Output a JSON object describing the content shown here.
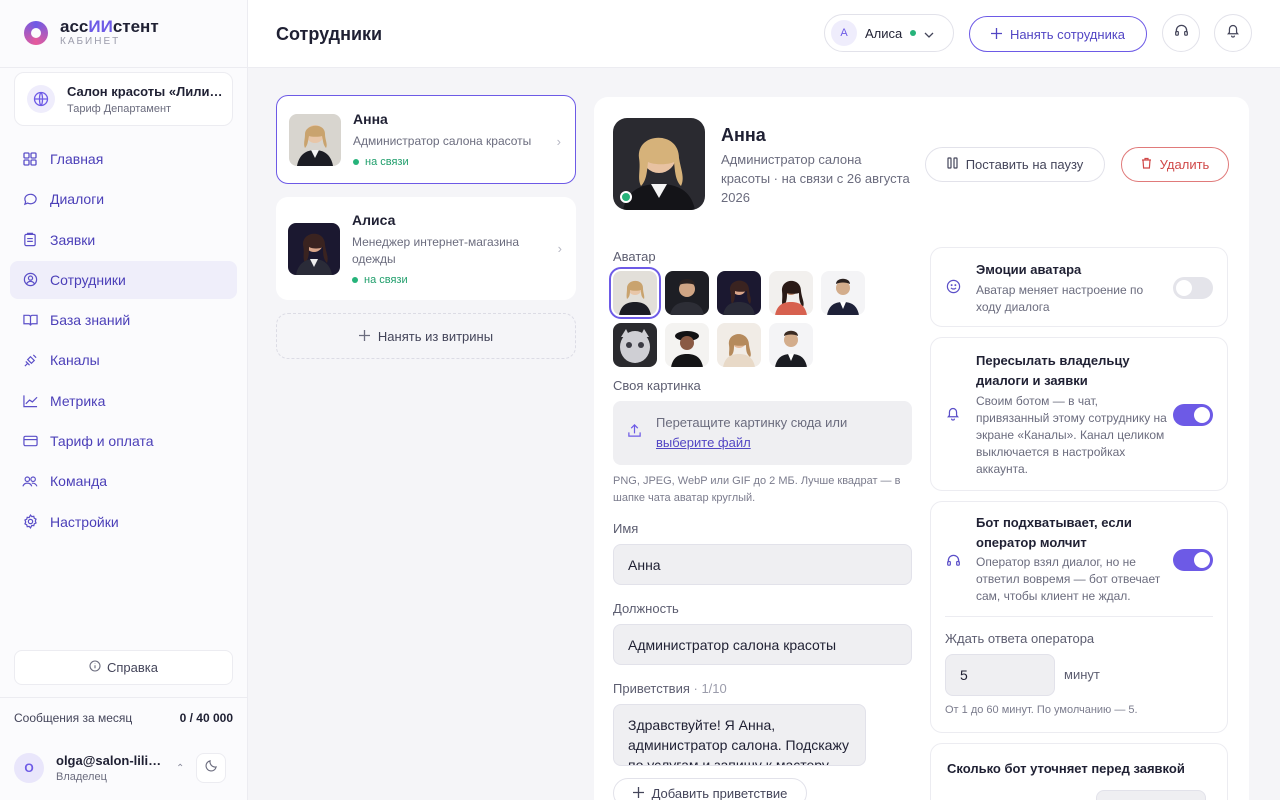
{
  "brand": {
    "name_a": "асс",
    "name_b": "ИИ",
    "name_c": "стент",
    "sub": "КАБИНЕТ"
  },
  "org": {
    "name": "Салон красоты «Лилия»",
    "plan": "Тариф Департамент"
  },
  "nav": [
    {
      "label": "Главная",
      "icon": "grid-icon"
    },
    {
      "label": "Диалоги",
      "icon": "chat-icon"
    },
    {
      "label": "Заявки",
      "icon": "clipboard-icon"
    },
    {
      "label": "Сотрудники",
      "icon": "user-circle-icon",
      "active": true
    },
    {
      "label": "База знаний",
      "icon": "book-icon"
    },
    {
      "label": "Каналы",
      "icon": "satellite-icon"
    },
    {
      "label": "Метрика",
      "icon": "chart-line-icon"
    },
    {
      "label": "Тариф и оплата",
      "icon": "card-icon"
    },
    {
      "label": "Команда",
      "icon": "team-icon"
    },
    {
      "label": "Настройки",
      "icon": "gear-icon"
    }
  ],
  "help_label": "Справка",
  "messages": {
    "label": "Сообщения за месяц",
    "value": "0 / 40 000"
  },
  "user": {
    "initial": "O",
    "email": "olga@salon-liliya.ru",
    "role": "Владелец"
  },
  "topbar": {
    "title": "Сотрудники",
    "agent_initial": "А",
    "agent_name": "Алиса",
    "hire_label": "Нанять сотрудника"
  },
  "employees": [
    {
      "name": "Анна",
      "role": "Администратор салона красоты",
      "status": "на связи"
    },
    {
      "name": "Алиса",
      "role": "Менеджер интернет-магазина одежды",
      "status": "на связи"
    }
  ],
  "hire_vitrina": "Нанять из витрины",
  "detail": {
    "name": "Анна",
    "subtitle": "Администратор салона красоты · на связи с 26 августа 2026",
    "pause_label": "Поставить на паузу",
    "delete_label": "Удалить",
    "avatar_label": "Аватар",
    "own_picture_label": "Своя картинка",
    "drop_text": "Перетащите картинку сюда или",
    "drop_link": "выберите файл",
    "hint": "PNG, JPEG, WebP или GIF до 2 МБ. Лучше квадрат — в шапке чата аватар круглый.",
    "name_label": "Имя",
    "name_value": "Анна",
    "role_label": "Должность",
    "role_value": "Администратор салона красоты",
    "greetings_label": "Приветствия",
    "greetings_count": "· 1/10",
    "greeting_text": "Здравствуйте! Я Анна, администратор салона. Подскажу по услугам и запишу к мастеру.",
    "add_greeting": "Добавить приветствие"
  },
  "settings": {
    "emotions": {
      "title": "Эмоции аватара",
      "desc": "Аватар меняет настроение по ходу диалога",
      "on": false
    },
    "forward": {
      "title": "Пересылать владельцу диалоги и заявки",
      "desc": "Своим ботом — в чат, привязанный этому сотруднику на экране «Каналы». Канал целиком выключается в настройках аккаунта.",
      "on": true
    },
    "pickup": {
      "title": "Бот подхватывает, если оператор молчит",
      "desc": "Оператор взял диалог, но не ответил вовремя — бот отвечает сам, чтобы клиент не ждал.",
      "on": true,
      "wait_label": "Ждать ответа оператора",
      "wait_value": "5",
      "wait_unit": "минут",
      "wait_hint": "От 1 до 60 минут. По умолчанию — 5."
    },
    "clarify": {
      "title": "Сколько бот уточняет перед заявкой"
    }
  },
  "colors": {
    "accent": "#6d5ae6",
    "online": "#26b37a",
    "danger": "#d04848"
  }
}
